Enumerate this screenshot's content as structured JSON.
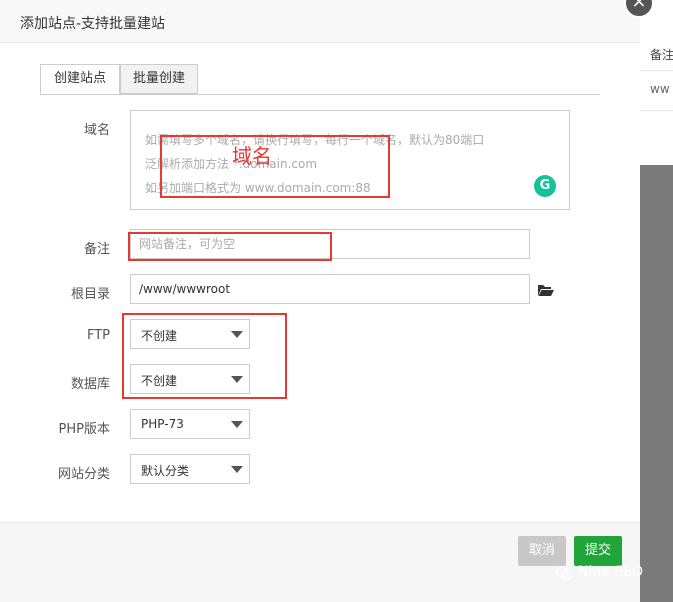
{
  "background": {
    "header_text": "备注",
    "row_text": "ww"
  },
  "modal": {
    "title": "添加站点-支持批量建站",
    "close_icon": "×",
    "tabs": [
      {
        "label": "创建站点",
        "active": true
      },
      {
        "label": "批量创建",
        "active": false
      }
    ],
    "form": {
      "domain": {
        "label": "域名",
        "placeholder_lines": [
          "如需填写多个域名，请换行填写，每行一个域名，默认为80端口",
          "泛解析添加方法 *.domain.com",
          "如另加端口格式为 www.domain.com:88"
        ],
        "grammarly_icon": "G"
      },
      "remark": {
        "label": "备注",
        "placeholder": "网站备注，可为空",
        "value": ""
      },
      "root_dir": {
        "label": "根目录",
        "value": "/www/wwwroot"
      },
      "ftp": {
        "label": "FTP",
        "selected": "不创建"
      },
      "database": {
        "label": "数据库",
        "selected": "不创建"
      },
      "php_version": {
        "label": "PHP版本",
        "selected": "PHP-73"
      },
      "site_category": {
        "label": "网站分类",
        "selected": "默认分类"
      }
    },
    "footer": {
      "cancel_label": "取消",
      "submit_label": "提交"
    }
  },
  "annotation": {
    "text": "域名",
    "color": "#e53935"
  },
  "watermark": {
    "text": "Nina SEO"
  },
  "colors": {
    "accent": "#20a53a",
    "annotation": "#e53935",
    "grammarly": "#15c39a"
  }
}
